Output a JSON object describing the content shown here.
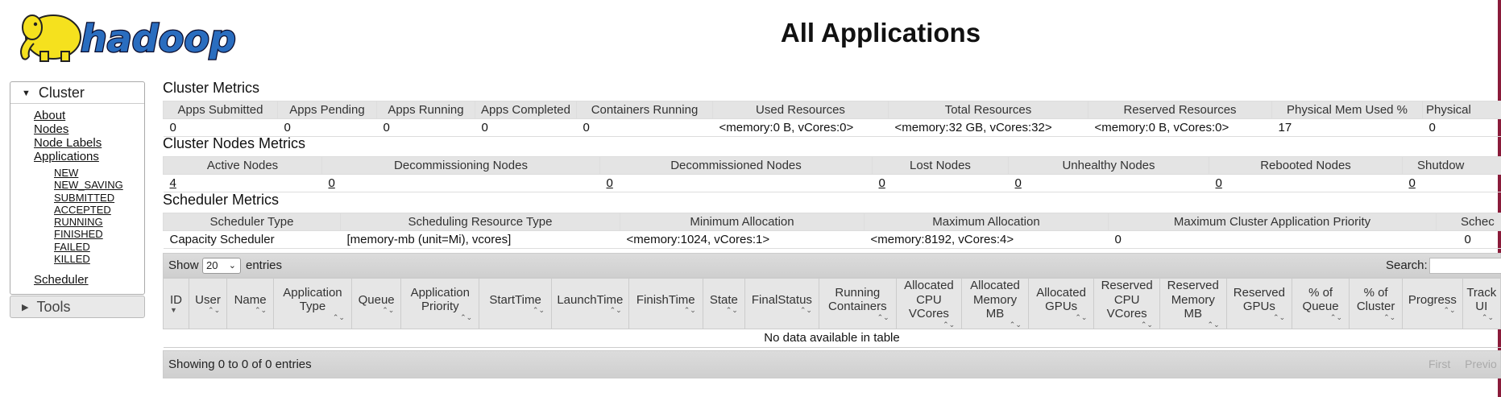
{
  "header": {
    "logo_text": "hadoop",
    "title": "All Applications"
  },
  "nav": {
    "cluster_label": "Cluster",
    "links": [
      "About",
      "Nodes",
      "Node Labels",
      "Applications"
    ],
    "app_states": [
      "NEW",
      "NEW_SAVING",
      "SUBMITTED",
      "ACCEPTED",
      "RUNNING",
      "FINISHED",
      "FAILED",
      "KILLED"
    ],
    "scheduler": "Scheduler",
    "tools_label": "Tools"
  },
  "cluster_metrics": {
    "title": "Cluster Metrics",
    "headers": [
      "Apps Submitted",
      "Apps Pending",
      "Apps Running",
      "Apps Completed",
      "Containers Running",
      "Used Resources",
      "Total Resources",
      "Reserved Resources",
      "Physical Mem Used %",
      "Physical"
    ],
    "values": [
      "0",
      "0",
      "0",
      "0",
      "0",
      "<memory:0 B, vCores:0>",
      "<memory:32 GB, vCores:32>",
      "<memory:0 B, vCores:0>",
      "17",
      "0"
    ]
  },
  "nodes_metrics": {
    "title": "Cluster Nodes Metrics",
    "headers": [
      "Active Nodes",
      "Decommissioning Nodes",
      "Decommissioned Nodes",
      "Lost Nodes",
      "Unhealthy Nodes",
      "Rebooted Nodes",
      "Shutdow"
    ],
    "values": [
      "4",
      "0",
      "0",
      "0",
      "0",
      "0",
      "0"
    ]
  },
  "scheduler_metrics": {
    "title": "Scheduler Metrics",
    "headers": [
      "Scheduler Type",
      "Scheduling Resource Type",
      "Minimum Allocation",
      "Maximum Allocation",
      "Maximum Cluster Application Priority",
      "Schec"
    ],
    "values": [
      "Capacity Scheduler",
      "[memory-mb (unit=Mi), vcores]",
      "<memory:1024, vCores:1>",
      "<memory:8192, vCores:4>",
      "0",
      "0"
    ]
  },
  "apps_table": {
    "show_label": "Show",
    "page_size": "20",
    "entries_label": "entries",
    "search_label": "Search:",
    "columns": [
      "ID",
      "User",
      "Name",
      "Application Type",
      "Queue",
      "Application Priority",
      "StartTime",
      "LaunchTime",
      "FinishTime",
      "State",
      "FinalStatus",
      "Running Containers",
      "Allocated CPU VCores",
      "Allocated Memory MB",
      "Allocated GPUs",
      "Reserved CPU VCores",
      "Reserved Memory MB",
      "Reserved GPUs",
      "% of Queue",
      "% of Cluster",
      "Progress",
      "Track UI"
    ],
    "empty_message": "No data available in table",
    "info": "Showing 0 to 0 of 0 entries",
    "pager": [
      "First",
      "Previo"
    ]
  }
}
